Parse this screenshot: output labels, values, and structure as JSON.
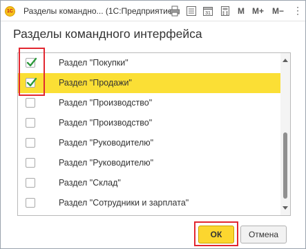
{
  "window": {
    "title": "Разделы командно... (1С:Предприятие)",
    "logo_text": "1С",
    "toolbar": {
      "icons": [
        "print-icon",
        "list-icon",
        "calendar-icon",
        "calculator-icon"
      ],
      "calendar_day": "31",
      "m_label": "M",
      "m_plus_label": "M+",
      "m_minus_label": "M−",
      "minimize_glyph": "_",
      "maximize_glyph": "□",
      "close_glyph": "×"
    }
  },
  "heading": "Разделы командного интерфейса",
  "list": {
    "items": [
      {
        "label": "Раздел \"Покупки\"",
        "checked": true,
        "selected": false
      },
      {
        "label": "Раздел \"Продажи\"",
        "checked": true,
        "selected": true
      },
      {
        "label": "Раздел \"Производство\"",
        "checked": false,
        "selected": false
      },
      {
        "label": "Раздел \"Производство\"",
        "checked": false,
        "selected": false
      },
      {
        "label": "Раздел \"Руководителю\"",
        "checked": false,
        "selected": false
      },
      {
        "label": "Раздел \"Руководителю\"",
        "checked": false,
        "selected": false
      },
      {
        "label": "Раздел \"Склад\"",
        "checked": false,
        "selected": false
      },
      {
        "label": "Раздел \"Сотрудники и зарплата\"",
        "checked": false,
        "selected": false
      }
    ]
  },
  "buttons": {
    "ok": "ОК",
    "cancel": "Отмена"
  },
  "colors": {
    "selected_row": "#fbdf35",
    "check_green": "#2e9a3a",
    "ok_button": "#fcd62f",
    "highlight_red": "#e2262f"
  }
}
